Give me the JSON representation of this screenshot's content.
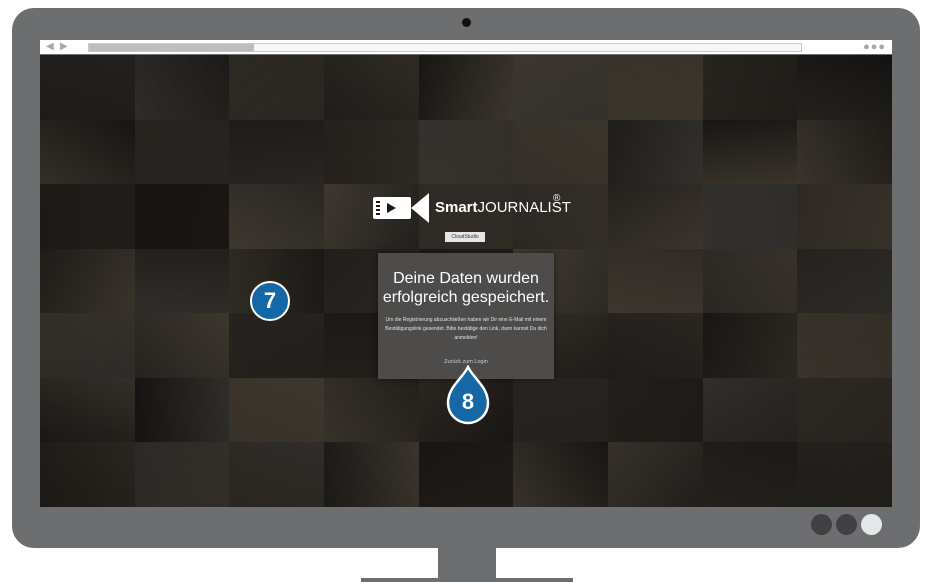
{
  "logo": {
    "text_bold": "Smart",
    "text_regular": "JOURNALIST",
    "registered_mark": "®",
    "sub_badge": "CloudStudio"
  },
  "card": {
    "title_line1": "Deine Daten wurden",
    "title_line2": "erfolgreich gespeichert.",
    "message": "Um die Registrierung abzuschließen haben wir Dir eine E-Mail mit einem Bestätigungslink gesendet. Bitte bestätige den Link, dann kannst Du dich anmelden!",
    "back_link": "Zurück zum Login"
  },
  "annotations": {
    "marker7": "7",
    "marker8": "8"
  },
  "colors": {
    "bezel": "#6d6e70",
    "card_background": "#4d4c4a",
    "marker_blue": "#1567a6",
    "screen_background": "#1c1a17"
  },
  "monitor_buttons": [
    {
      "name": "button-1",
      "color": "#414042"
    },
    {
      "name": "button-2",
      "color": "#414042"
    },
    {
      "name": "button-3",
      "color": "#e6e7e8"
    }
  ]
}
